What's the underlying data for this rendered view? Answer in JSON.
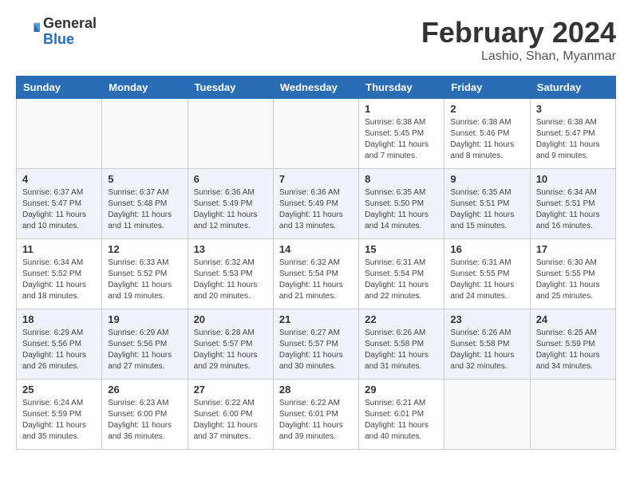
{
  "header": {
    "logo_general": "General",
    "logo_blue": "Blue",
    "month_title": "February 2024",
    "location": "Lashio, Shan, Myanmar"
  },
  "days_of_week": [
    "Sunday",
    "Monday",
    "Tuesday",
    "Wednesday",
    "Thursday",
    "Friday",
    "Saturday"
  ],
  "weeks": [
    {
      "days": [
        {
          "num": "",
          "info": ""
        },
        {
          "num": "",
          "info": ""
        },
        {
          "num": "",
          "info": ""
        },
        {
          "num": "",
          "info": ""
        },
        {
          "num": "1",
          "info": "Sunrise: 6:38 AM\nSunset: 5:45 PM\nDaylight: 11 hours\nand 7 minutes."
        },
        {
          "num": "2",
          "info": "Sunrise: 6:38 AM\nSunset: 5:46 PM\nDaylight: 11 hours\nand 8 minutes."
        },
        {
          "num": "3",
          "info": "Sunrise: 6:38 AM\nSunset: 5:47 PM\nDaylight: 11 hours\nand 9 minutes."
        }
      ]
    },
    {
      "days": [
        {
          "num": "4",
          "info": "Sunrise: 6:37 AM\nSunset: 5:47 PM\nDaylight: 11 hours\nand 10 minutes."
        },
        {
          "num": "5",
          "info": "Sunrise: 6:37 AM\nSunset: 5:48 PM\nDaylight: 11 hours\nand 11 minutes."
        },
        {
          "num": "6",
          "info": "Sunrise: 6:36 AM\nSunset: 5:49 PM\nDaylight: 11 hours\nand 12 minutes."
        },
        {
          "num": "7",
          "info": "Sunrise: 6:36 AM\nSunset: 5:49 PM\nDaylight: 11 hours\nand 13 minutes."
        },
        {
          "num": "8",
          "info": "Sunrise: 6:35 AM\nSunset: 5:50 PM\nDaylight: 11 hours\nand 14 minutes."
        },
        {
          "num": "9",
          "info": "Sunrise: 6:35 AM\nSunset: 5:51 PM\nDaylight: 11 hours\nand 15 minutes."
        },
        {
          "num": "10",
          "info": "Sunrise: 6:34 AM\nSunset: 5:51 PM\nDaylight: 11 hours\nand 16 minutes."
        }
      ]
    },
    {
      "days": [
        {
          "num": "11",
          "info": "Sunrise: 6:34 AM\nSunset: 5:52 PM\nDaylight: 11 hours\nand 18 minutes."
        },
        {
          "num": "12",
          "info": "Sunrise: 6:33 AM\nSunset: 5:52 PM\nDaylight: 11 hours\nand 19 minutes."
        },
        {
          "num": "13",
          "info": "Sunrise: 6:32 AM\nSunset: 5:53 PM\nDaylight: 11 hours\nand 20 minutes."
        },
        {
          "num": "14",
          "info": "Sunrise: 6:32 AM\nSunset: 5:54 PM\nDaylight: 11 hours\nand 21 minutes."
        },
        {
          "num": "15",
          "info": "Sunrise: 6:31 AM\nSunset: 5:54 PM\nDaylight: 11 hours\nand 22 minutes."
        },
        {
          "num": "16",
          "info": "Sunrise: 6:31 AM\nSunset: 5:55 PM\nDaylight: 11 hours\nand 24 minutes."
        },
        {
          "num": "17",
          "info": "Sunrise: 6:30 AM\nSunset: 5:55 PM\nDaylight: 11 hours\nand 25 minutes."
        }
      ]
    },
    {
      "days": [
        {
          "num": "18",
          "info": "Sunrise: 6:29 AM\nSunset: 5:56 PM\nDaylight: 11 hours\nand 26 minutes."
        },
        {
          "num": "19",
          "info": "Sunrise: 6:29 AM\nSunset: 5:56 PM\nDaylight: 11 hours\nand 27 minutes."
        },
        {
          "num": "20",
          "info": "Sunrise: 6:28 AM\nSunset: 5:57 PM\nDaylight: 11 hours\nand 29 minutes."
        },
        {
          "num": "21",
          "info": "Sunrise: 6:27 AM\nSunset: 5:57 PM\nDaylight: 11 hours\nand 30 minutes."
        },
        {
          "num": "22",
          "info": "Sunrise: 6:26 AM\nSunset: 5:58 PM\nDaylight: 11 hours\nand 31 minutes."
        },
        {
          "num": "23",
          "info": "Sunrise: 6:26 AM\nSunset: 5:58 PM\nDaylight: 11 hours\nand 32 minutes."
        },
        {
          "num": "24",
          "info": "Sunrise: 6:25 AM\nSunset: 5:59 PM\nDaylight: 11 hours\nand 34 minutes."
        }
      ]
    },
    {
      "days": [
        {
          "num": "25",
          "info": "Sunrise: 6:24 AM\nSunset: 5:59 PM\nDaylight: 11 hours\nand 35 minutes."
        },
        {
          "num": "26",
          "info": "Sunrise: 6:23 AM\nSunset: 6:00 PM\nDaylight: 11 hours\nand 36 minutes."
        },
        {
          "num": "27",
          "info": "Sunrise: 6:22 AM\nSunset: 6:00 PM\nDaylight: 11 hours\nand 37 minutes."
        },
        {
          "num": "28",
          "info": "Sunrise: 6:22 AM\nSunset: 6:01 PM\nDaylight: 11 hours\nand 39 minutes."
        },
        {
          "num": "29",
          "info": "Sunrise: 6:21 AM\nSunset: 6:01 PM\nDaylight: 11 hours\nand 40 minutes."
        },
        {
          "num": "",
          "info": ""
        },
        {
          "num": "",
          "info": ""
        }
      ]
    }
  ]
}
